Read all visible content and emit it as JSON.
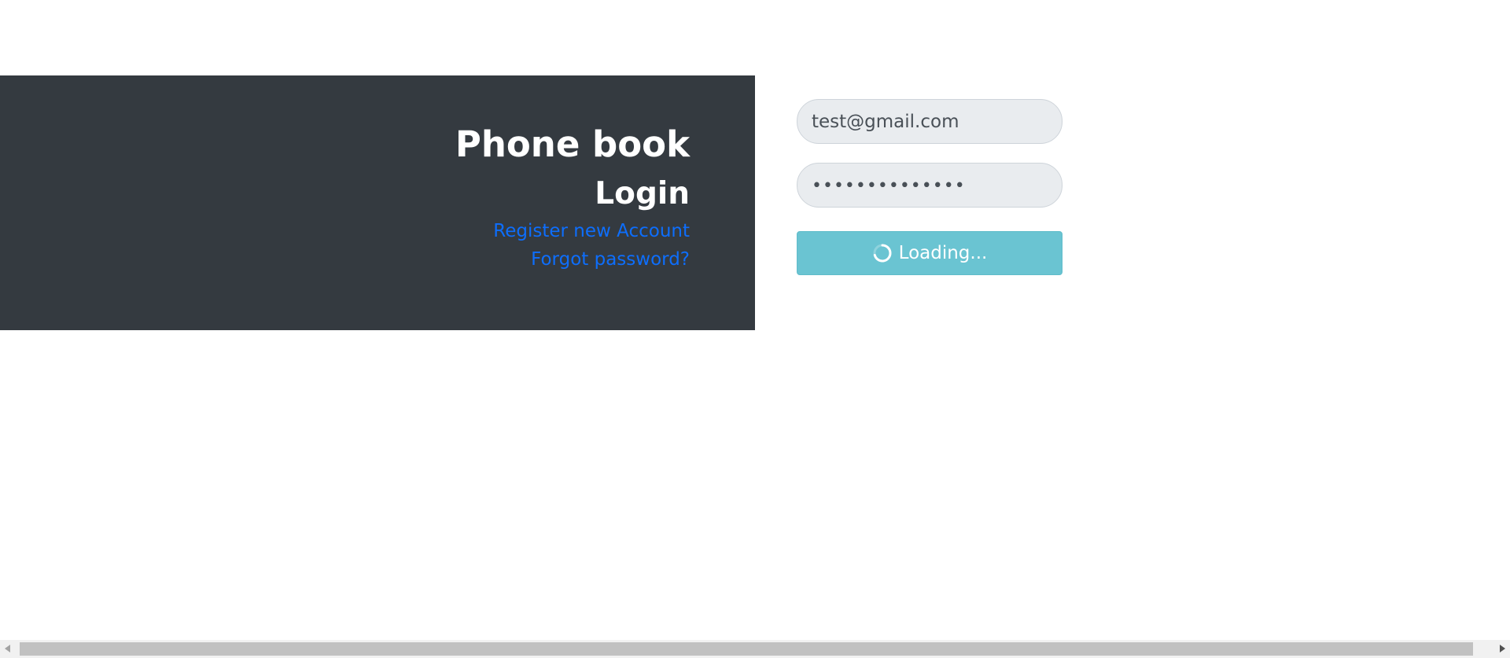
{
  "brand": {
    "title": "Phone book",
    "subtitle": "Login"
  },
  "links": {
    "register": "Register new Account",
    "forgot": "Forgot password?"
  },
  "form": {
    "email_value": "test@gmail.com",
    "password_masked": "••••••••••••••",
    "submit_label": "Loading..."
  },
  "colors": {
    "panel_bg": "#343a40",
    "link": "#0d6efd",
    "button_bg": "#6ac4d2",
    "input_bg": "#e9ecef"
  },
  "icons": {
    "spinner": "loading-spinner-icon",
    "scroll_left": "scroll-left-arrow-icon",
    "scroll_right": "scroll-right-arrow-icon"
  }
}
